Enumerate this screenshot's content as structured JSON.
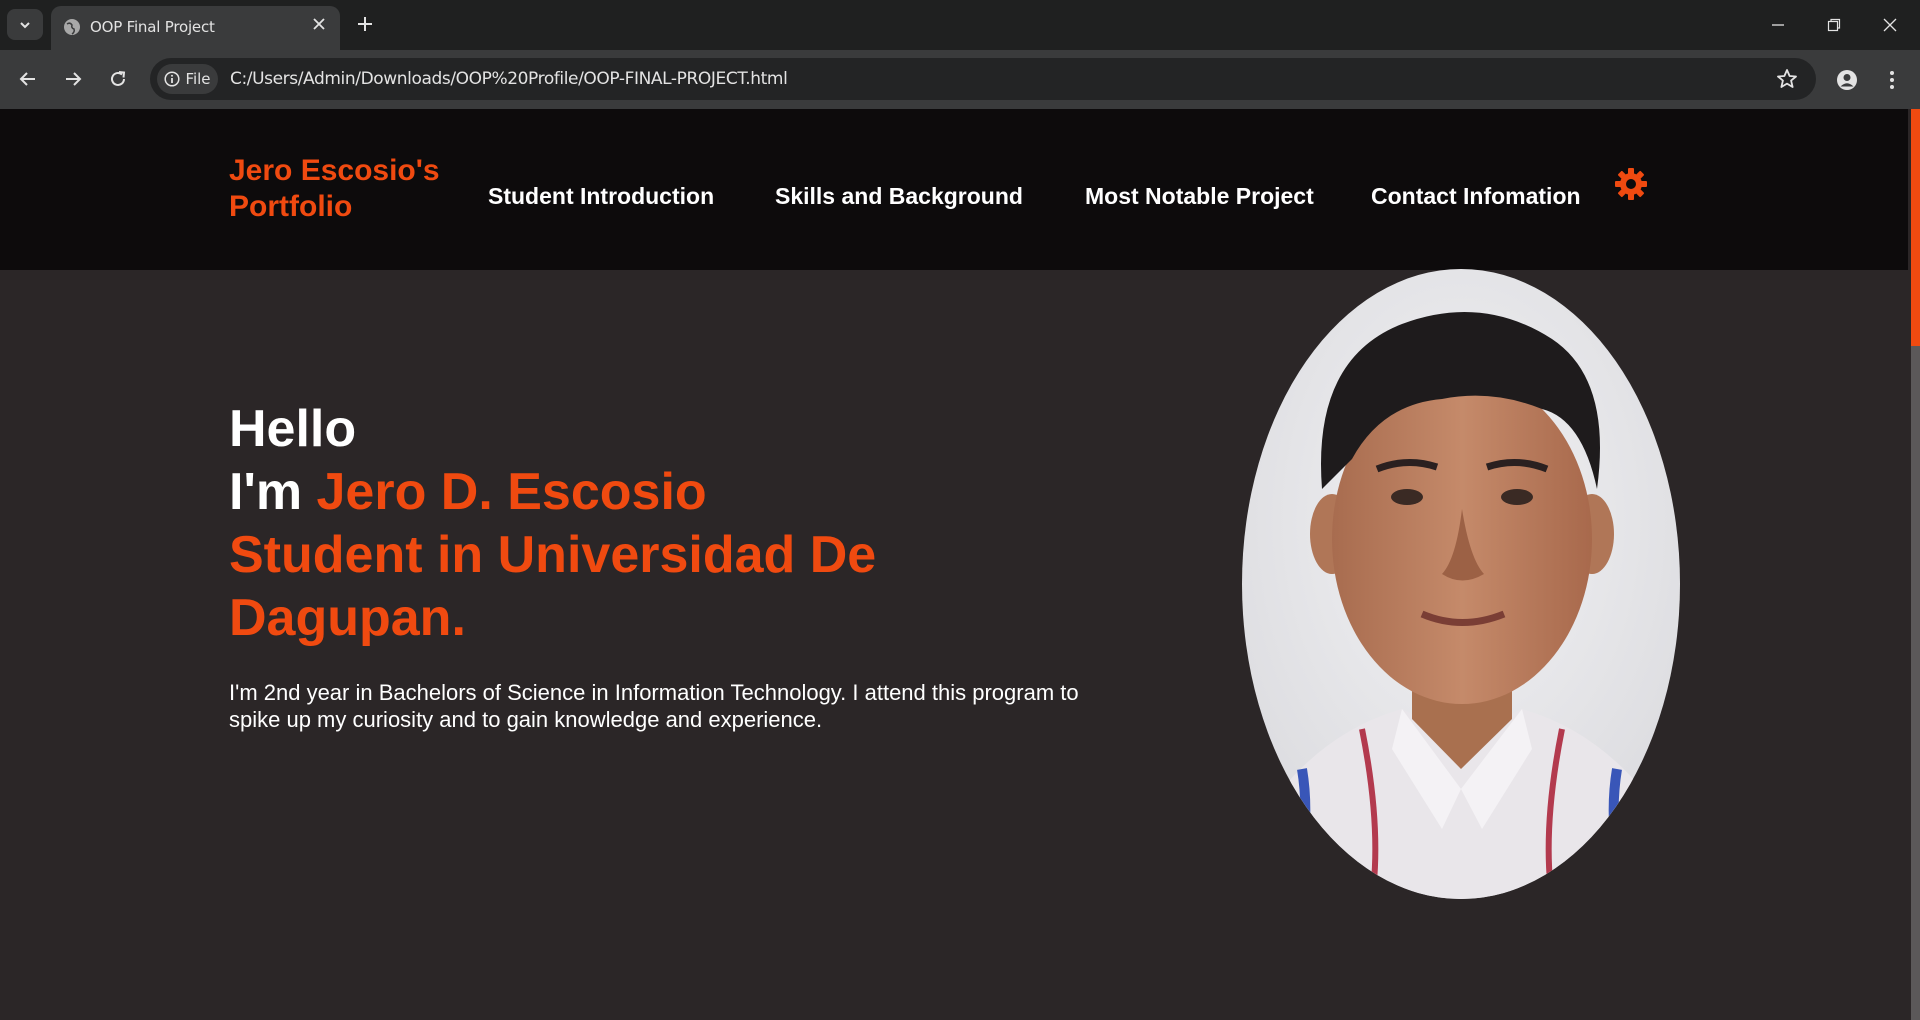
{
  "browser": {
    "tab_title": "OOP Final Project",
    "site_chip_label": "File",
    "url": "C:/Users/Admin/Downloads/OOP%20Profile/OOP-FINAL-PROJECT.html"
  },
  "site": {
    "logo_line1": "Jero Escosio's",
    "logo_line2": "Portfolio",
    "nav": [
      {
        "label": "Student Introduction"
      },
      {
        "label": "Skills and Background"
      },
      {
        "label": "Most Notable Project"
      },
      {
        "label": "Contact Infomation"
      }
    ],
    "accent_color": "#f04a10"
  },
  "hero": {
    "greeting": "Hello",
    "im_prefix": "I'm ",
    "name": "Jero D. Escosio",
    "role_line1": "Student in Universidad De",
    "role_line2": "Dagupan.",
    "description_line1": "I'm 2nd year in Bachelors of Science in Information Technology. I attend this program to",
    "description_line2": "spike up my curiosity and to gain knowledge and experience."
  }
}
